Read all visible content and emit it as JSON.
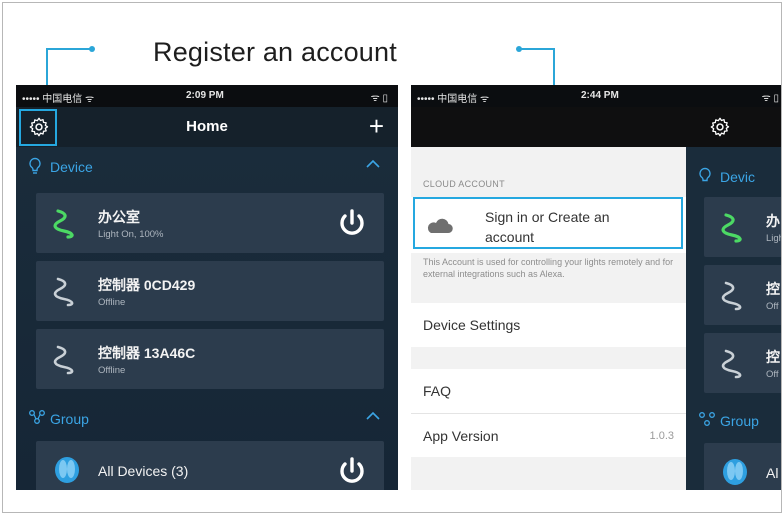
{
  "caption": "Register an account",
  "colors": {
    "accent": "#2ba6d8",
    "nav": "#15212b",
    "section": "#3ba5e5",
    "card": "#2c3c4d"
  },
  "phone1": {
    "status": {
      "carrier": "••••• 中国电信 ᯤ",
      "time": "2:09 PM",
      "battery": "ᯤ ▯"
    },
    "nav": {
      "title": "Home",
      "add_label": "+"
    },
    "sections": {
      "device": {
        "label": "Device"
      },
      "group": {
        "label": "Group"
      }
    },
    "devices": [
      {
        "name": "办公室",
        "status": "Light On, 100%"
      },
      {
        "name": "控制器 0CD429",
        "status": "Offline"
      },
      {
        "name": "控制器 13A46C",
        "status": "Offline"
      }
    ],
    "groups": [
      {
        "name": "All Devices (3)"
      }
    ]
  },
  "phone2": {
    "status": {
      "carrier": "••••• 中国电信 ᯤ",
      "time": "2:44 PM",
      "battery": "ᯤ ▯"
    },
    "menu": {
      "cloud_header": "CLOUD ACCOUNT",
      "signin_label": "Sign in or Create an account",
      "description": "This Account is used for controlling your lights remotely and for external integrations such as Alexa.",
      "device_settings": "Device Settings",
      "faq": "FAQ",
      "app_version_label": "App Version",
      "app_version_value": "1.0.3"
    },
    "peek": {
      "section": "Devic",
      "group": "Group",
      "card1_name": "办",
      "card1_sub": "Ligh",
      "card2_name": "控",
      "card2_sub": "Off",
      "card3_name": "控",
      "card3_sub": "Off",
      "group_card": "Al"
    }
  }
}
